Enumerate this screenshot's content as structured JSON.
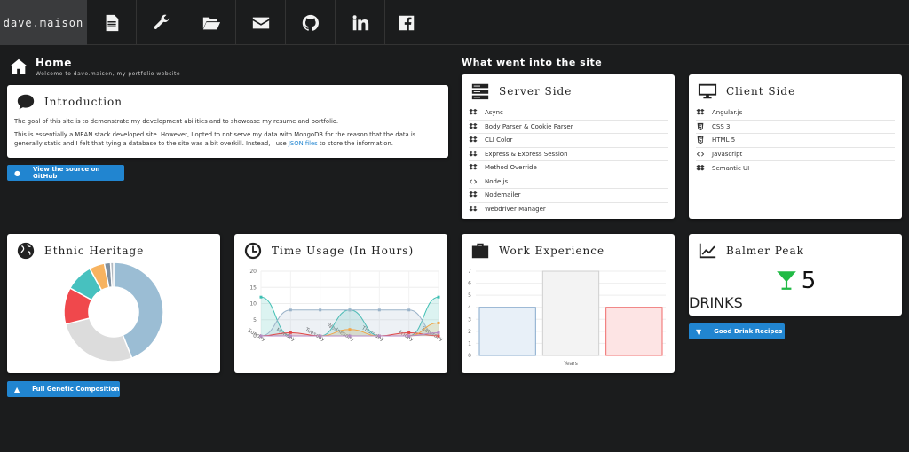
{
  "nav": {
    "brand": "dave.maison",
    "items": [
      {
        "name": "resume-icon"
      },
      {
        "name": "wrench-icon"
      },
      {
        "name": "folder-open-icon"
      },
      {
        "name": "mail-icon"
      },
      {
        "name": "github-icon"
      },
      {
        "name": "linkedin-icon"
      },
      {
        "name": "facebook-icon"
      }
    ]
  },
  "home": {
    "title": "Home",
    "subtitle": "Welcome to dave.maison, my portfolio website"
  },
  "intro": {
    "title": "Introduction",
    "p1": "The goal of this site is to demonstrate my development abilities and to showcase my resume and portfolio.",
    "p2_a": "This is essentially a MEAN stack developed site. However, I opted to not serve my data with MongoDB for the reason that the data is generally static and I felt that tying a database to the site was a bit overkill. Instead, I use ",
    "p2_link": "JSON files",
    "p2_b": " to store the information.",
    "button": "View the source on GitHub"
  },
  "site": {
    "title": "What went into the site",
    "server": {
      "title": "Server Side",
      "items": [
        "Async",
        "Body Parser & Cookie Parser",
        "CLI Color",
        "Express & Express Session",
        "Method Override",
        "Node.js",
        "Nodemailer",
        "Webdriver Manager"
      ]
    },
    "client": {
      "title": "Client Side",
      "items": [
        "Angular.js",
        "CSS 3",
        "HTML 5",
        "Javascript",
        "Semantic UI"
      ]
    }
  },
  "heritage": {
    "title": "Ethnic Heritage",
    "button": "Full Genetic Composition"
  },
  "time": {
    "title": "Time Usage (In Hours)"
  },
  "work": {
    "title": "Work Experience"
  },
  "balmer": {
    "title": "Balmer Peak",
    "value": "5",
    "unit": "DRINKS",
    "button": "Good Drink Recipes"
  },
  "chart_data": [
    {
      "type": "pie",
      "title": "Ethnic Heritage",
      "values": [
        44,
        27,
        12,
        9,
        5,
        2,
        1
      ],
      "colors": [
        "#9bbdd4",
        "#dcdcdc",
        "#f0484c",
        "#47c1bf",
        "#f7b360",
        "#7f8f9f",
        "#b0b8c0"
      ]
    },
    {
      "type": "line",
      "title": "Time Usage (In Hours)",
      "categories": [
        "Sunday",
        "Monday",
        "Tuesday",
        "Wednesday",
        "Thursday",
        "Friday",
        "Saturday"
      ],
      "ylim": [
        0,
        20
      ],
      "yticks": [
        0,
        5,
        10,
        15,
        20
      ],
      "series": [
        {
          "color": "#3ebfb3",
          "values": [
            12,
            0,
            0,
            8,
            0,
            0,
            12
          ]
        },
        {
          "color": "#9bb3c9",
          "values": [
            0,
            8,
            8,
            8,
            8,
            8,
            0
          ]
        },
        {
          "color": "#e04848",
          "values": [
            0,
            1,
            0,
            0,
            0,
            1,
            0
          ]
        },
        {
          "color": "#f0a64a",
          "values": [
            0,
            0,
            0,
            2,
            0,
            0,
            4
          ]
        },
        {
          "color": "#b58ac4",
          "values": [
            0,
            0,
            0,
            0,
            0,
            0,
            1
          ]
        }
      ]
    },
    {
      "type": "bar",
      "title": "Work Experience",
      "xlabel": "Years",
      "ylim": [
        0,
        7
      ],
      "yticks": [
        0,
        1,
        2,
        3,
        4,
        5,
        6,
        7
      ],
      "series": [
        {
          "value": 4,
          "color": "#86aacd",
          "fill": "#e8f0f8"
        },
        {
          "value": 7,
          "color": "#cfcfcf",
          "fill": "#f3f3f3"
        },
        {
          "value": 4,
          "color": "#f06a6a",
          "fill": "#fde4e4"
        }
      ]
    }
  ]
}
